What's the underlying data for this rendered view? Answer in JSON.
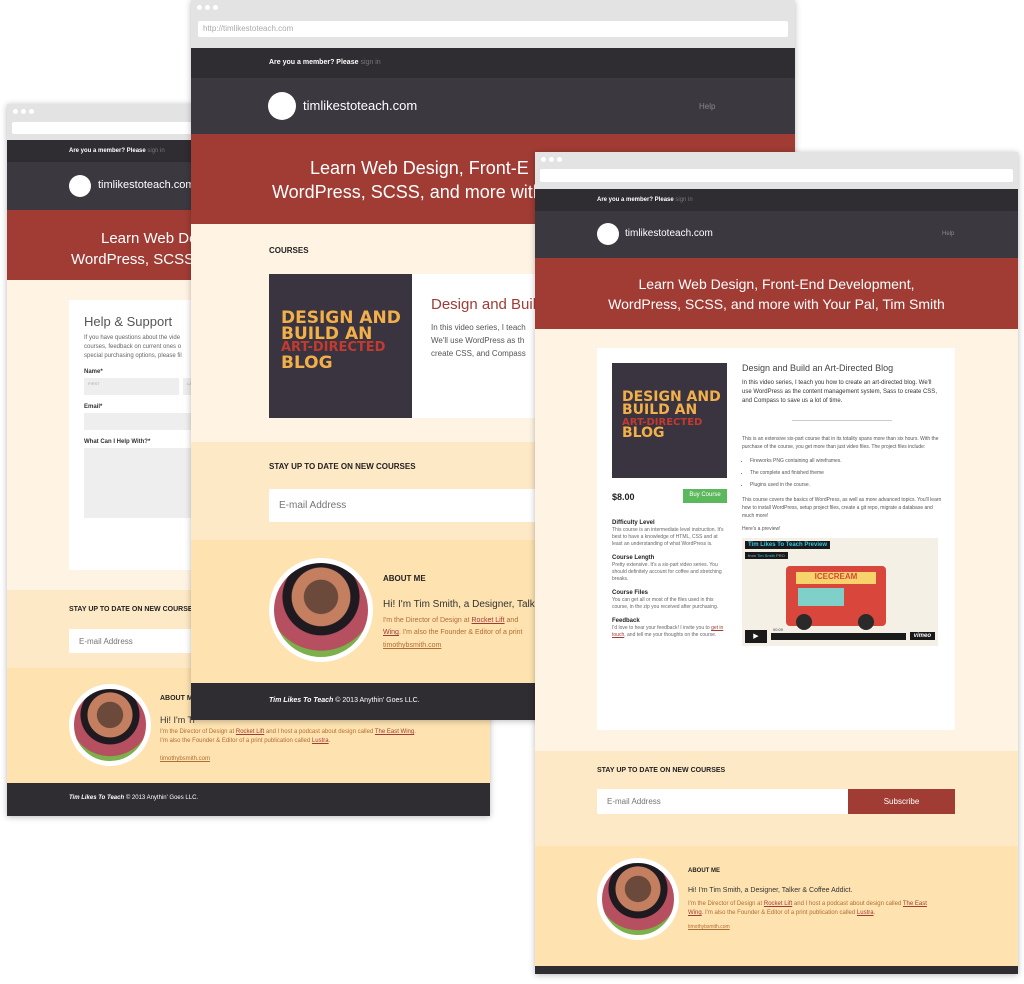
{
  "common": {
    "member_prompt": "Are you a member? Please",
    "sign_in": "sign in",
    "logo_text": "timlikestoteach.com",
    "help": "Help",
    "hero_line1": "Learn Web Design, Front-End Development,",
    "hero_line2": "WordPress, SCSS, and more with Your Pal, Tim Smith",
    "hero_line1_left": "Learn Web De",
    "hero_line2_left": "WordPress, SCSS,",
    "hero_line1_mid": "Learn Web Design, Front-E",
    "hero_line2_mid": "WordPress, SCSS, and more with",
    "stay_up_to_date": "STAY UP TO DATE ON NEW COURSES",
    "email_placeholder": "E-mail Address",
    "subscribe": "Subscribe",
    "about_heading": "ABOUT ME",
    "about_heading_left": "ABOUT M",
    "about_intro": "Hi! I'm Tim Smith, a Designer, Talker & Coffee Addict.",
    "about_intro_mid": "Hi! I'm Tim Smith, a Designer, Talker",
    "about_intro_left": "Hi! I'm Ti",
    "about_p1": "I'm the Director of Design at",
    "rocket_lift": "Rocket Lift",
    "about_p2": "and I host a podcast about design called",
    "the_east_wing": "The East Wing",
    "about_p3": ". I'm also the Founder & Editor of a print publication called",
    "lustra": "Lustra",
    "about_mid_line1a": "I'm the Director of Design at",
    "about_mid_line1b": "and",
    "about_mid_line2a": "Wing",
    "about_mid_line2b": ". I'm also the Founder & Editor of a print",
    "site_link": "timothybsmith.com",
    "footer_brand": "Tim Likes To Teach",
    "footer_rest": "© 2013 Anythin' Goes LLC."
  },
  "left_window": {
    "address": "",
    "help_title": "Help & Support",
    "help_text_1": "If you have questions about the vide",
    "help_text_2": "courses, feedback on current ones o",
    "help_text_3": "special purchasing options, please fil",
    "name_label": "Name*",
    "first": "FIRST",
    "last": "LA",
    "email_label": "Email*",
    "help_label": "What Can I Help With?*"
  },
  "middle_window": {
    "address": "http://timlikestoteach.com",
    "courses_heading": "COURSES",
    "course_title": "Design and Buil",
    "course_desc_1": "In this video series, I teach",
    "course_desc_2": "We'll use WordPress as th",
    "course_desc_3": "create CSS, and Compass"
  },
  "thumb": {
    "line1": "DESIGN AND",
    "line2": "BUILD AN",
    "line3": "ART-DIRECTED",
    "line4": "BLOG"
  },
  "right_window": {
    "address": "",
    "course_title": "Design and Build an Art-Directed Blog",
    "intro": "In this video series, I teach you how to create an art-directed blog. We'll use WordPress as the content management system, Sass to create CSS, and Compass to save us a lot of time.",
    "p1": "This is an extensive six-part course that in its totality spans more than six hours. With the purchase of the course, you get more than just video files. The project files include:",
    "bullets": [
      "Fireworks PNG containing all wireframes.",
      "The complete and finished theme",
      "Plugins used in the course."
    ],
    "p2": "This course covers the basics of WordPress, as well as more advanced topics. You'll learn how to install WordPress, setup project files, create a git repo, migrate a database and much more!",
    "preview_label": "Here's a preview!",
    "video_title": "Tim Likes To Teach Preview",
    "video_from": "from",
    "video_author": "Tim Smith",
    "video_badge": "PRO",
    "video_time": "00:09",
    "vimeo": "vimeo",
    "truck_sign": "ICECREAM",
    "price": "$8.00",
    "buy": "Buy Course",
    "difficulty_h": "Difficulty Level",
    "difficulty_t": "This course is an intermediate level instruction. It's best to have a knowledge of HTML, CSS and at least an understanding of what WordPress is.",
    "length_h": "Course Length",
    "length_t": "Pretty extensive. It's a six-part video series. You should definitely account for coffee and stretching breaks.",
    "files_h": "Course Files",
    "files_t": "You can get all or most of the files used in this course, in the zip you received after purchasing.",
    "feedback_h": "Feedback",
    "feedback_t1": "I'd love to hear your feedback! I invite you to",
    "get_in_touch": "get in touch",
    "feedback_t2": ", and tell me your thoughts on the course."
  }
}
